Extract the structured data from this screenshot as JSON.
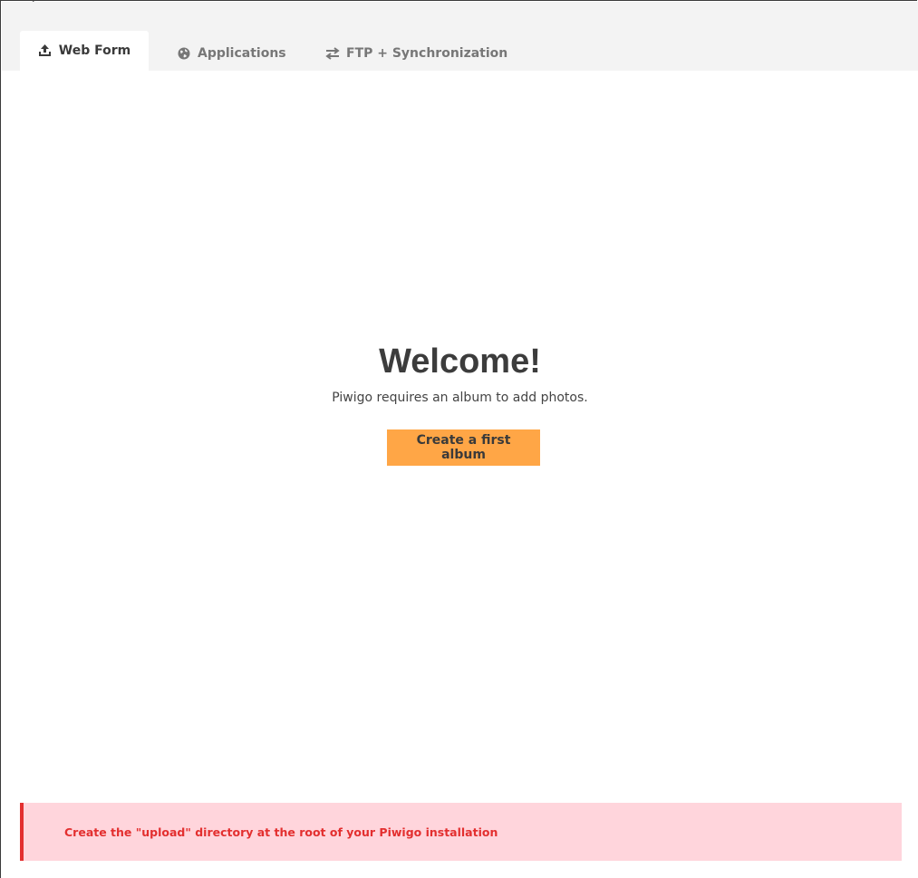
{
  "header": {
    "title_fragment": "P"
  },
  "tabs": [
    {
      "label": "Web Form",
      "icon": "upload-icon",
      "active": true
    },
    {
      "label": "Applications",
      "icon": "globe-icon",
      "active": false
    },
    {
      "label": "FTP + Synchronization",
      "icon": "sync-arrows-icon",
      "active": false
    }
  ],
  "welcome": {
    "title": "Welcome!",
    "text": "Piwigo requires an album to add photos.",
    "button_label": "Create a first album"
  },
  "error": {
    "message": "Create the \"upload\" directory at the root of your Piwigo installation"
  },
  "colors": {
    "accent": "#ffa646",
    "error_text": "#e32f2f",
    "error_bg": "#ffd5dc",
    "tabbar_bg": "#f3f3f3"
  }
}
